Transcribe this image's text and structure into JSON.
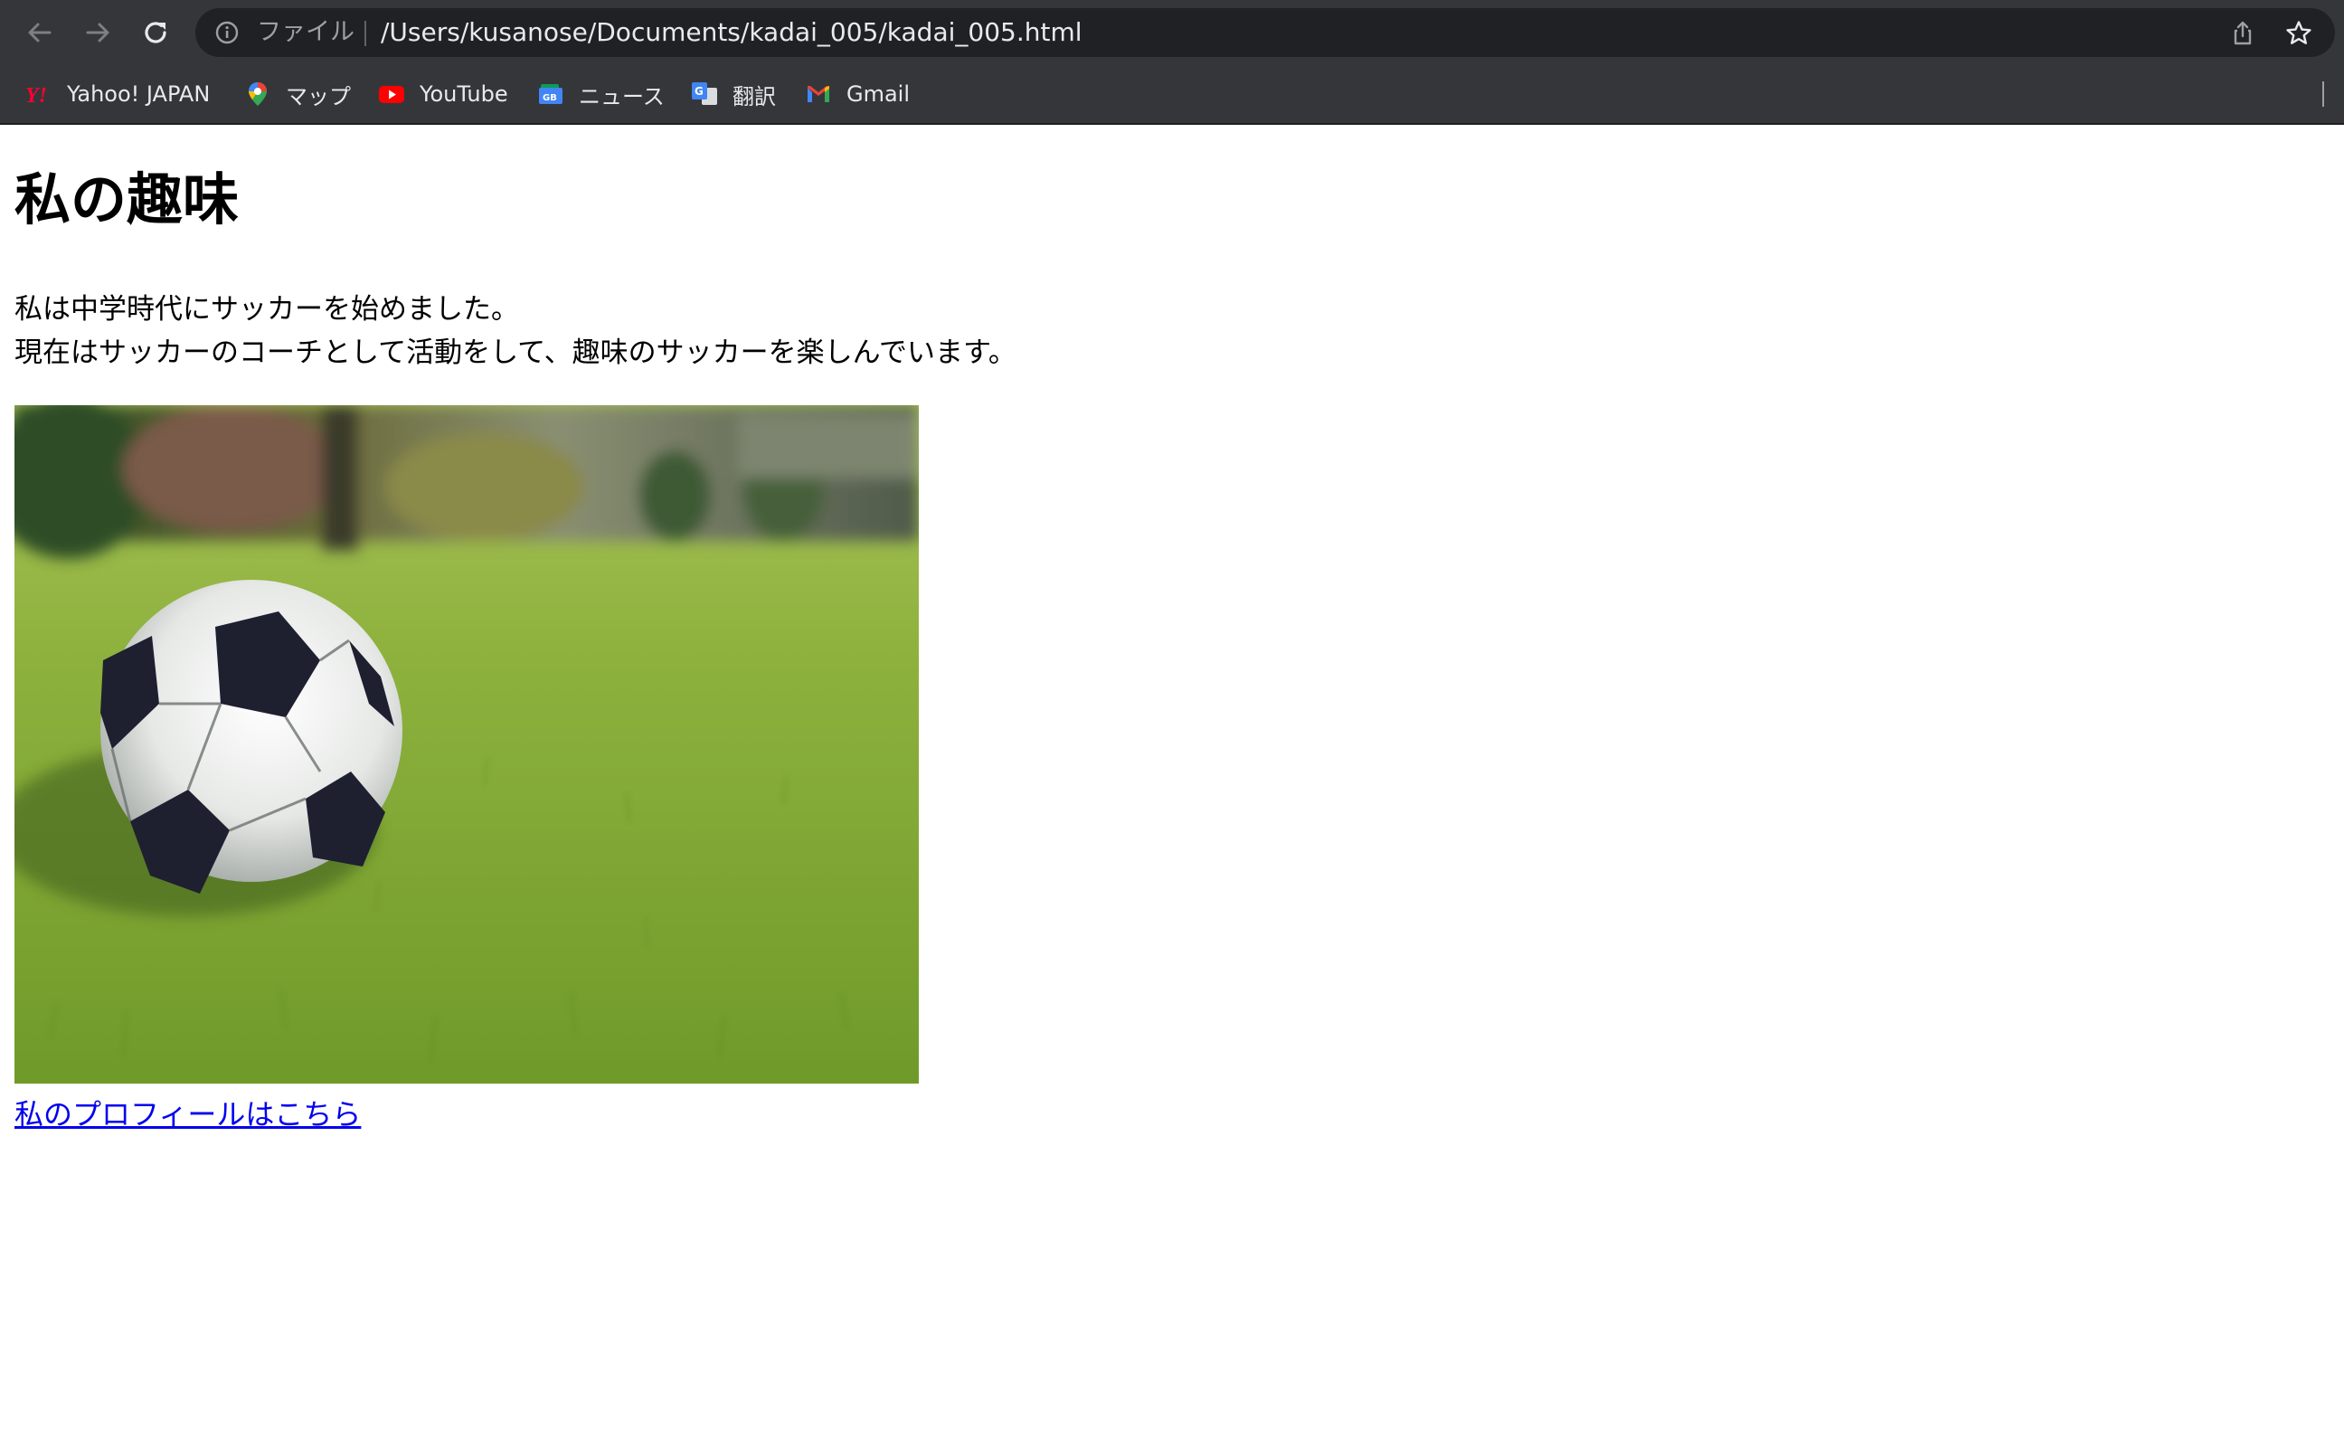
{
  "browser": {
    "address_bar": {
      "scheme_chip": "ファイル",
      "url": "/Users/kusanose/Documents/kadai_005/kadai_005.html"
    },
    "bookmarks": [
      {
        "label": "Yahoo! JAPAN",
        "icon": "yahoo-japan-icon"
      },
      {
        "label": "マップ",
        "icon": "google-maps-icon"
      },
      {
        "label": "YouTube",
        "icon": "youtube-icon"
      },
      {
        "label": "ニュース",
        "icon": "google-news-icon"
      },
      {
        "label": "翻訳",
        "icon": "google-translate-icon"
      },
      {
        "label": "Gmail",
        "icon": "gmail-icon"
      }
    ],
    "colors": {
      "toolbar": "#35363a",
      "omnibox": "#202124",
      "text": "#e8eaed"
    }
  },
  "page": {
    "title": "私の趣味",
    "paragraph_lines": [
      "私は中学時代にサッカーを始めました。",
      "現在はサッカーのコーチとして活動をして、趣味のサッカーを楽しんでいます。"
    ],
    "image": {
      "subject": "soccer-ball-on-grass"
    },
    "link_text": "私のプロフィールはこちら",
    "link_color": "#0000ee"
  }
}
